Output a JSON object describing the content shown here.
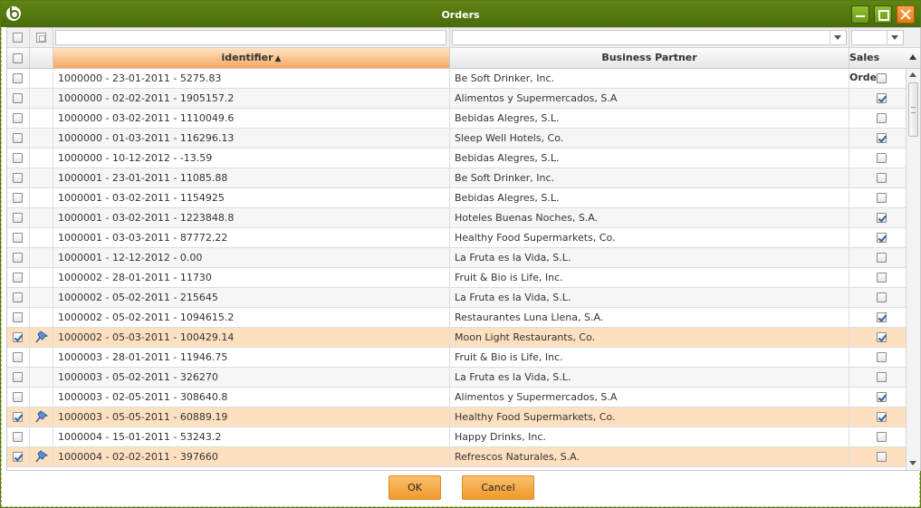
{
  "window": {
    "title": "Orders"
  },
  "grid": {
    "columns": {
      "identifier": "identifier",
      "business_partner": "Business Partner",
      "sales_order": "Sales Order"
    },
    "filters": {
      "identifier_value": "",
      "business_partner_value": "",
      "sales_order_value": ""
    },
    "rows": [
      {
        "identifier": "1000000 - 23-01-2011 - 5275.83",
        "partner": "Be Soft Drinker, Inc.",
        "sales_order": false,
        "selected": false
      },
      {
        "identifier": "1000000 - 02-02-2011 - 1905157.2",
        "partner": "Alimentos y Supermercados, S.A",
        "sales_order": true,
        "selected": false
      },
      {
        "identifier": "1000000 - 03-02-2011 - 1110049.6",
        "partner": "Bebidas Alegres, S.L.",
        "sales_order": false,
        "selected": false
      },
      {
        "identifier": "1000000 - 01-03-2011 - 116296.13",
        "partner": "Sleep Well Hotels, Co.",
        "sales_order": true,
        "selected": false
      },
      {
        "identifier": "1000000 - 10-12-2012 - -13.59",
        "partner": "Bebidas Alegres, S.L.",
        "sales_order": false,
        "selected": false
      },
      {
        "identifier": "1000001 - 23-01-2011 - 11085.88",
        "partner": "Be Soft Drinker, Inc.",
        "sales_order": false,
        "selected": false
      },
      {
        "identifier": "1000001 - 03-02-2011 - 1154925",
        "partner": "Bebidas Alegres, S.L.",
        "sales_order": false,
        "selected": false
      },
      {
        "identifier": "1000001 - 03-02-2011 - 1223848.8",
        "partner": "Hoteles Buenas Noches, S.A.",
        "sales_order": true,
        "selected": false
      },
      {
        "identifier": "1000001 - 03-03-2011 - 87772.22",
        "partner": "Healthy Food Supermarkets, Co.",
        "sales_order": true,
        "selected": false
      },
      {
        "identifier": "1000001 - 12-12-2012 - 0.00",
        "partner": "La Fruta es la Vida, S.L.",
        "sales_order": false,
        "selected": false
      },
      {
        "identifier": "1000002 - 28-01-2011 - 11730",
        "partner": "Fruit & Bio is Life, Inc.",
        "sales_order": false,
        "selected": false
      },
      {
        "identifier": "1000002 - 05-02-2011 - 215645",
        "partner": "La Fruta es la Vida, S.L.",
        "sales_order": false,
        "selected": false
      },
      {
        "identifier": "1000002 - 05-02-2011 - 1094615.2",
        "partner": "Restaurantes Luna Llena, S.A.",
        "sales_order": true,
        "selected": false
      },
      {
        "identifier": "1000002 - 05-03-2011 - 100429.14",
        "partner": "Moon Light Restaurants, Co.",
        "sales_order": true,
        "selected": true
      },
      {
        "identifier": "1000003 - 28-01-2011 - 11946.75",
        "partner": "Fruit & Bio is Life, Inc.",
        "sales_order": false,
        "selected": false
      },
      {
        "identifier": "1000003 - 05-02-2011 - 326270",
        "partner": "La Fruta es la Vida, S.L.",
        "sales_order": false,
        "selected": false
      },
      {
        "identifier": "1000003 - 02-05-2011 - 308640.8",
        "partner": "Alimentos y Supermercados, S.A",
        "sales_order": true,
        "selected": false
      },
      {
        "identifier": "1000003 - 05-05-2011 - 60889.19",
        "partner": "Healthy Food Supermarkets, Co.",
        "sales_order": true,
        "selected": true
      },
      {
        "identifier": "1000004 - 15-01-2011 - 53243.2",
        "partner": "Happy Drinks, Inc.",
        "sales_order": false,
        "selected": false
      },
      {
        "identifier": "1000004 - 02-02-2011 - 397660",
        "partner": "Refrescos Naturales, S.A.",
        "sales_order": false,
        "selected": true
      }
    ]
  },
  "buttons": {
    "ok": "OK",
    "cancel": "Cancel"
  },
  "colors": {
    "titlebar": "#4a6b0a",
    "selected_row": "#fde0c0",
    "button": "#ef9a2d"
  }
}
